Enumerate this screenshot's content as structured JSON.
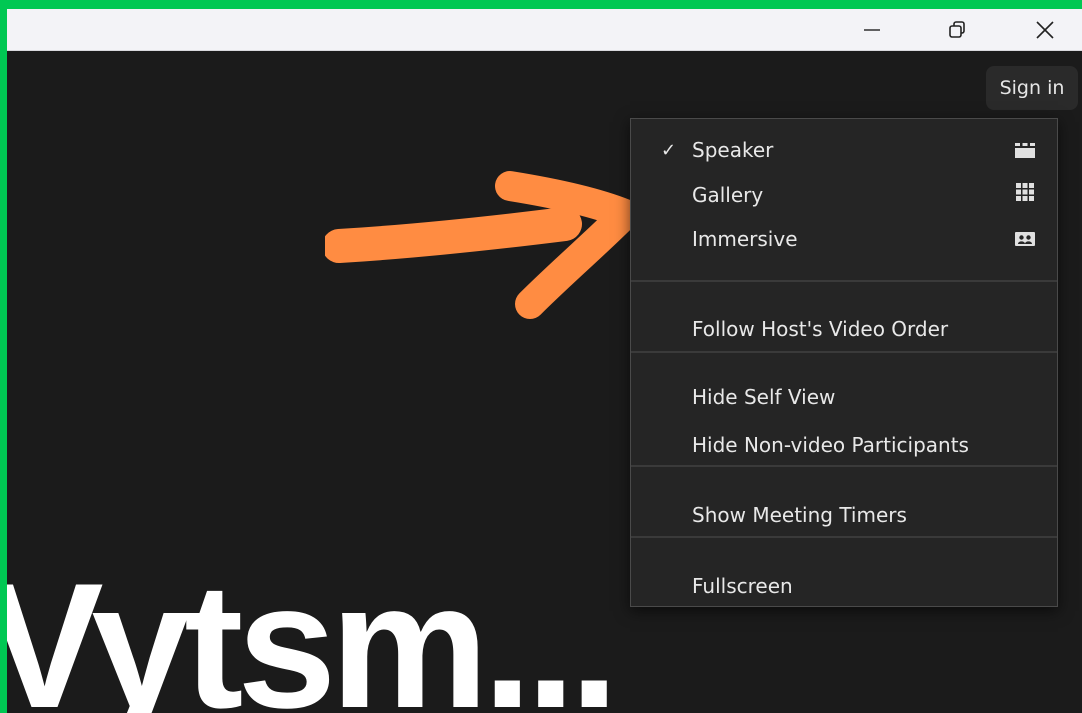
{
  "window": {
    "controls": [
      "minimize-icon",
      "restore-icon",
      "close-icon"
    ]
  },
  "header": {
    "sign_in_label": "Sign in"
  },
  "meeting": {
    "name_text": "Vytsm..."
  },
  "view_menu": {
    "items": [
      {
        "label": "Speaker",
        "checked": true,
        "icon": "speaker-view-icon"
      },
      {
        "label": "Gallery",
        "checked": false,
        "icon": "gallery-grid-icon"
      },
      {
        "label": "Immersive",
        "checked": false,
        "icon": "immersive-view-icon"
      },
      {
        "label": "Follow Host's Video Order"
      },
      {
        "label": "Hide Self View"
      },
      {
        "label": "Hide Non-video Participants"
      },
      {
        "label": "Show Meeting Timers"
      },
      {
        "label": "Fullscreen"
      }
    ],
    "check_glyph": "✓"
  },
  "colors": {
    "frame": "#00c853",
    "background": "#1b1b1b",
    "menu": "#252525",
    "arrow": "#ff8c42"
  }
}
